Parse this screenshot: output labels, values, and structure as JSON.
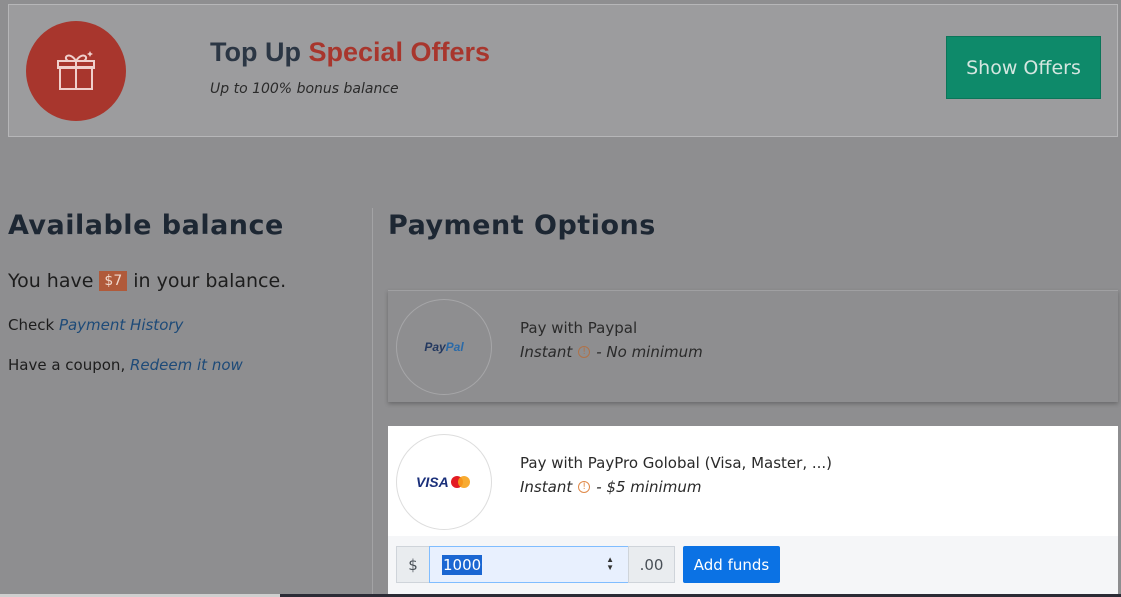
{
  "promo": {
    "title_part1": "Top Up",
    "title_part2": "Special Offers",
    "subtitle": "Up to 100% bonus balance",
    "button_label": "Show Offers",
    "icon": "gift-icon"
  },
  "balance": {
    "heading": "Available balance",
    "prefix": "You have",
    "amount": "$7",
    "suffix": "in your balance.",
    "check_prefix": "Check",
    "history_link": "Payment History",
    "coupon_prefix": "Have a coupon,",
    "redeem_link": "Redeem it now"
  },
  "payment": {
    "heading": "Payment Options",
    "options": [
      {
        "name": "Pay with Paypal",
        "speed": "Instant",
        "limit": "- No minimum",
        "logo": "PayPal"
      },
      {
        "name": "Pay with PayPro Golobal (Visa, Master, ...)",
        "speed": "Instant",
        "limit": "- $5 minimum",
        "logo": "VISA"
      }
    ],
    "currency_symbol": "$",
    "amount_value": "1000",
    "cents": ".00",
    "add_funds_label": "Add funds"
  },
  "colors": {
    "accent_red": "#a8362d",
    "offer_green": "#0e8a6a",
    "primary_blue": "#0b72e4"
  }
}
